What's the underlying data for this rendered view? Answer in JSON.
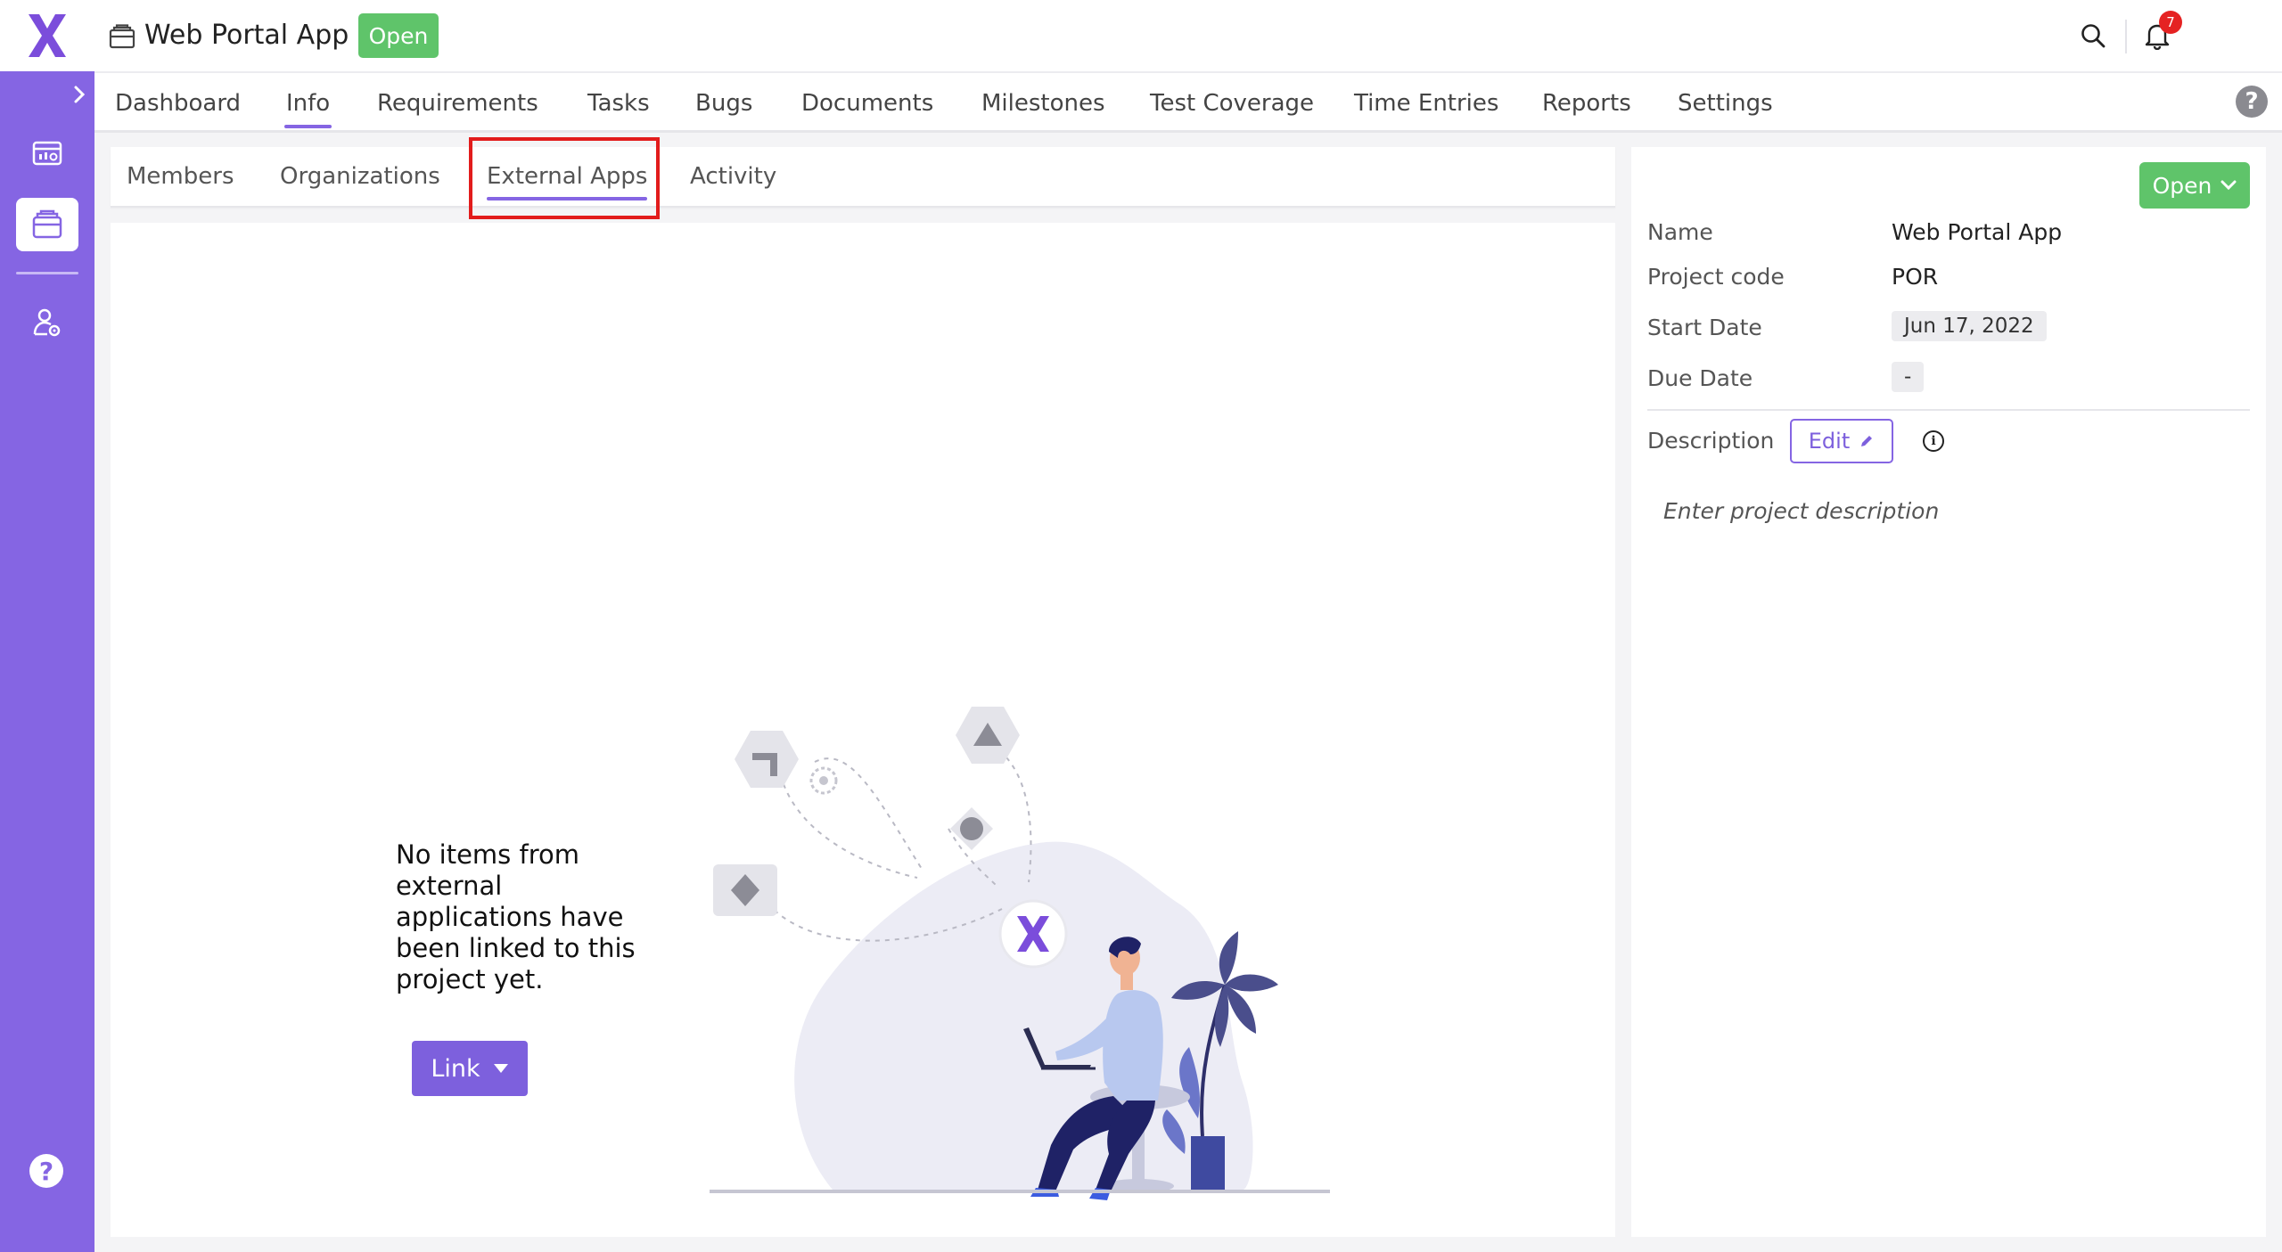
{
  "app": {
    "logo_icon": "x-logo-icon",
    "brand_color": "#8565e3",
    "accent_green": "#5fc46a",
    "highlight_red": "#e21c1c"
  },
  "header": {
    "project_icon": "project-folder-icon",
    "project_title": "Web Portal App",
    "status": "Open",
    "search_icon": "search-icon",
    "notifications_icon": "bell-icon",
    "notification_count": "7",
    "avatar_icon": "user-avatar"
  },
  "sidebar": {
    "expand_icon": "chevron-right-icon",
    "items": [
      {
        "icon": "dashboard-card-icon",
        "active": false
      },
      {
        "icon": "projects-folder-icon",
        "active": true
      },
      {
        "icon": "user-settings-icon",
        "active": false
      }
    ],
    "help_label": "?"
  },
  "main_nav": {
    "tabs": [
      {
        "label": "Dashboard"
      },
      {
        "label": "Info",
        "active": true
      },
      {
        "label": "Requirements"
      },
      {
        "label": "Tasks"
      },
      {
        "label": "Bugs"
      },
      {
        "label": "Documents"
      },
      {
        "label": "Milestones"
      },
      {
        "label": "Test Coverage"
      },
      {
        "label": "Time Entries"
      },
      {
        "label": "Reports"
      },
      {
        "label": "Settings"
      }
    ],
    "help_label": "?"
  },
  "sub_tabs": {
    "tabs": [
      {
        "label": "Members"
      },
      {
        "label": "Organizations"
      },
      {
        "label": "External Apps",
        "active": true
      },
      {
        "label": "Activity"
      }
    ]
  },
  "external_apps": {
    "empty_message": "No items from external applications have been linked to this project yet.",
    "link_button": "Link",
    "illustration": "person-with-laptop-illustration"
  },
  "details": {
    "status_button": "Open",
    "fields": {
      "name_label": "Name",
      "name_value": "Web Portal App",
      "code_label": "Project code",
      "code_value": "POR",
      "start_label": "Start Date",
      "start_value": "Jun 17, 2022",
      "due_label": "Due Date",
      "due_value": "-"
    },
    "description_label": "Description",
    "edit_button": "Edit",
    "info_icon_text": "i",
    "description_placeholder": "Enter project description"
  }
}
